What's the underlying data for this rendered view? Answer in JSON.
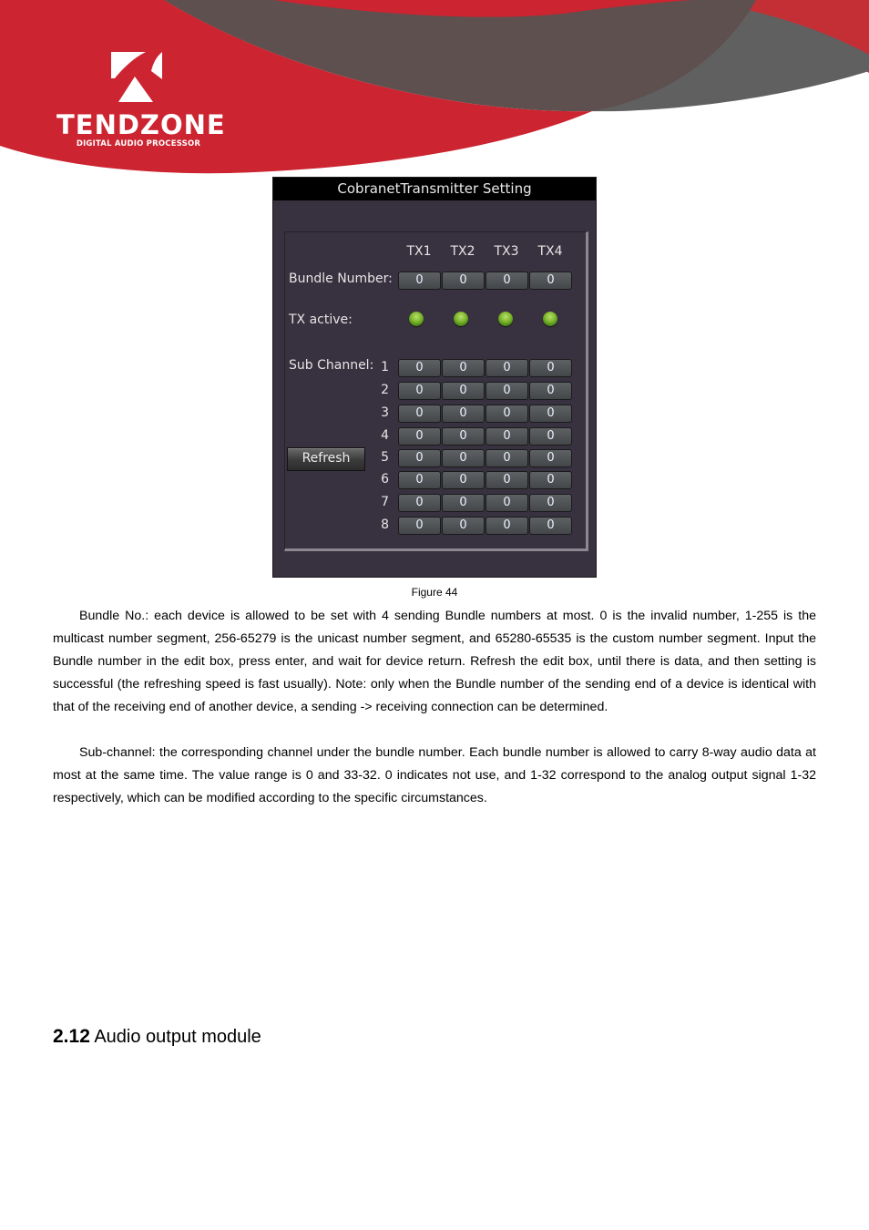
{
  "header": {
    "brand": "TENDZONE",
    "tagline": "DIGITAL AUDIO PROCESSOR",
    "colors": {
      "red": "#cc2430",
      "dark_brown": "#5e504e",
      "gray": "#606060"
    }
  },
  "dialog": {
    "title": "CobranetTransmitter Setting",
    "columns": [
      "TX1",
      "TX2",
      "TX3",
      "TX4"
    ],
    "bundle_label": "Bundle Number:",
    "bundle_values": [
      "0",
      "0",
      "0",
      "0"
    ],
    "tx_active_label": "TX active:",
    "tx_active": [
      true,
      true,
      true,
      true
    ],
    "sub_channel_label": "Sub Channel:",
    "sub_channels": [
      {
        "num": "1",
        "values": [
          "0",
          "0",
          "0",
          "0"
        ]
      },
      {
        "num": "2",
        "values": [
          "0",
          "0",
          "0",
          "0"
        ]
      },
      {
        "num": "3",
        "values": [
          "0",
          "0",
          "0",
          "0"
        ]
      },
      {
        "num": "4",
        "values": [
          "0",
          "0",
          "0",
          "0"
        ]
      },
      {
        "num": "5",
        "values": [
          "0",
          "0",
          "0",
          "0"
        ]
      },
      {
        "num": "6",
        "values": [
          "0",
          "0",
          "0",
          "0"
        ]
      },
      {
        "num": "7",
        "values": [
          "0",
          "0",
          "0",
          "0"
        ]
      },
      {
        "num": "8",
        "values": [
          "0",
          "0",
          "0",
          "0"
        ]
      }
    ],
    "refresh_label": "Refresh",
    "led_color": "#7cb52c"
  },
  "caption": "Figure 44",
  "paragraphs": [
    "Bundle No.: each device is allowed to be set with 4 sending Bundle numbers at most. 0 is the invalid number, 1-255 is the multicast number segment, 256-65279 is the unicast number segment, and 65280-65535 is the custom number segment. Input the Bundle number in the edit box, press enter, and wait for device return. Refresh the edit box, until there is data, and then setting is successful (the refreshing speed is fast usually). Note: only when the Bundle number of the sending end of a device is identical with that of the receiving end of another device, a sending -> receiving connection can be determined.",
    "Sub-channel: the corresponding channel under the bundle number. Each bundle number is allowed to carry 8-way audio data at most at the same time. The value range is 0 and 33-32. 0 indicates not use, and 1-32 correspond to the analog output signal 1-32 respectively, which can be modified according to the specific circumstances."
  ],
  "section": {
    "number": "2.12",
    "title": "Audio output module"
  }
}
